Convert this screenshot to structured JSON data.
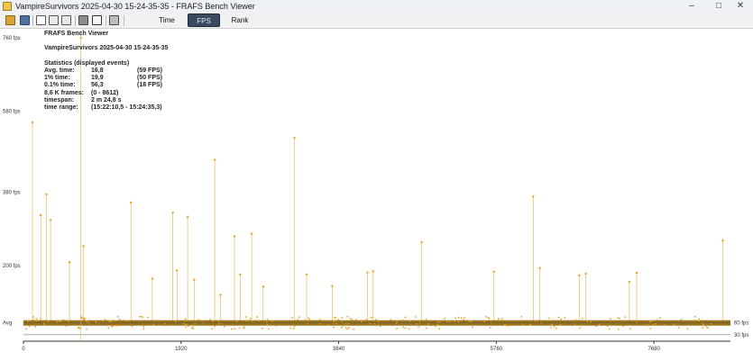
{
  "window": {
    "title": "VampireSurvivors 2025-04-30 15-24-35-35 - FRAFS Bench Viewer",
    "minimize_glyph": "–",
    "maximize_glyph": "□",
    "close_glyph": "✕"
  },
  "toolbar": {
    "icons": [
      "open-icon",
      "save-icon",
      "copy-icon",
      "fit-height-icon",
      "fit-width-icon",
      "settings-icon",
      "text-icon",
      "print-icon"
    ],
    "tabs": [
      {
        "label": "Time",
        "active": false
      },
      {
        "label": "FPS",
        "active": true
      },
      {
        "label": "Rank",
        "active": false
      }
    ]
  },
  "stats": {
    "app_name": "FRAFS Bench Viewer",
    "file_name": "VampireSurvivors 2025-04-30 15-24-35-35",
    "heading": "Statistics (displayed events)",
    "rows": [
      {
        "label": "Avg. time:",
        "value": "16,8",
        "extra": "(59 FPS)"
      },
      {
        "label": "1% time:",
        "value": "19,9",
        "extra": "(50 FPS)"
      },
      {
        "label": "0.1% time:",
        "value": "56,3",
        "extra": "(18 FPS)"
      },
      {
        "label": "8,6 K frames:",
        "value": "(0 - 8612)",
        "extra": ""
      },
      {
        "label": "timespan:",
        "value": "2 m 24,8 s",
        "extra": ""
      },
      {
        "label": "time range:",
        "value": "(15:22:10,5 - 15:24:35,3)",
        "extra": ""
      }
    ]
  },
  "chart_data": {
    "type": "scatter",
    "y_ticks": [
      {
        "value": 760,
        "label": "760 fps"
      },
      {
        "value": 580,
        "label": "580 fps"
      },
      {
        "value": 380,
        "label": "380 fps"
      },
      {
        "value": 200,
        "label": "200 fps"
      }
    ],
    "x_ticks": [
      0,
      1920,
      3840,
      5760,
      7680
    ],
    "xlim": [
      0,
      8612
    ],
    "avg_label": "Avg",
    "avg_fps": 59,
    "ref_lines": [
      {
        "value": 60,
        "label": "60 fps"
      },
      {
        "value": 30,
        "label": "30 fps"
      }
    ],
    "colors": {
      "points": "#e8a21a",
      "band": "#8f6400",
      "avg_line": "#5b5b5b"
    },
    "spikes": [
      {
        "x": 110,
        "fps": 552
      },
      {
        "x": 210,
        "fps": 324
      },
      {
        "x": 280,
        "fps": 375
      },
      {
        "x": 330,
        "fps": 312
      },
      {
        "x": 560,
        "fps": 208
      },
      {
        "x": 700,
        "fps": 760
      },
      {
        "x": 730,
        "fps": 248
      },
      {
        "x": 1310,
        "fps": 355
      },
      {
        "x": 1570,
        "fps": 168
      },
      {
        "x": 1820,
        "fps": 330
      },
      {
        "x": 1870,
        "fps": 188
      },
      {
        "x": 2000,
        "fps": 320
      },
      {
        "x": 2080,
        "fps": 165
      },
      {
        "x": 2330,
        "fps": 460
      },
      {
        "x": 2400,
        "fps": 128
      },
      {
        "x": 2570,
        "fps": 272
      },
      {
        "x": 2640,
        "fps": 178
      },
      {
        "x": 2780,
        "fps": 278
      },
      {
        "x": 2920,
        "fps": 148
      },
      {
        "x": 3300,
        "fps": 514
      },
      {
        "x": 3450,
        "fps": 178
      },
      {
        "x": 3760,
        "fps": 150
      },
      {
        "x": 4190,
        "fps": 183
      },
      {
        "x": 4260,
        "fps": 186
      },
      {
        "x": 4850,
        "fps": 258
      },
      {
        "x": 5730,
        "fps": 185
      },
      {
        "x": 6210,
        "fps": 370
      },
      {
        "x": 6290,
        "fps": 194
      },
      {
        "x": 6770,
        "fps": 176
      },
      {
        "x": 6850,
        "fps": 180
      },
      {
        "x": 7380,
        "fps": 160
      },
      {
        "x": 7470,
        "fps": 182
      },
      {
        "x": 8520,
        "fps": 262
      }
    ]
  }
}
